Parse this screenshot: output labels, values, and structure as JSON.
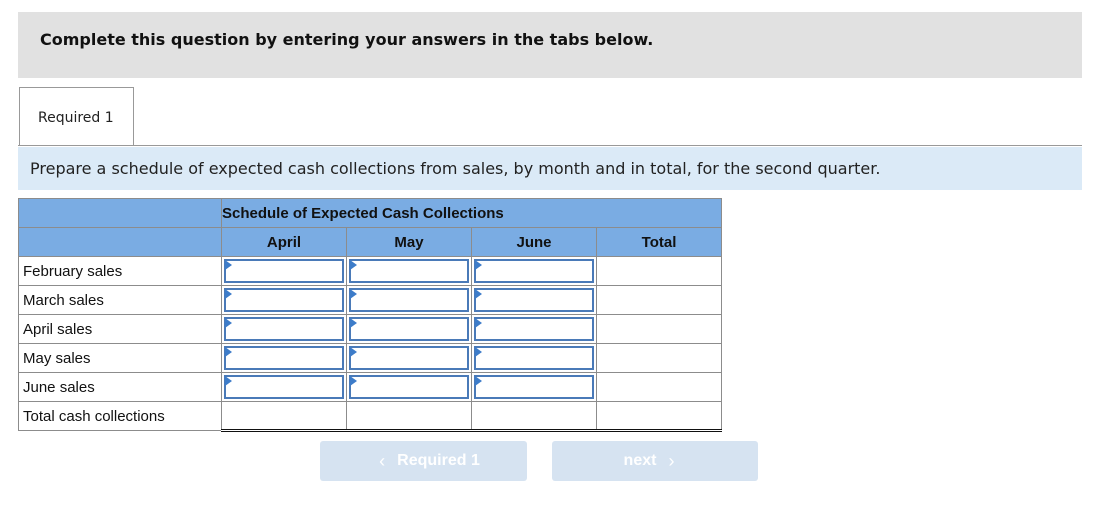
{
  "banner": {
    "text": "Complete this question by entering your answers in the tabs below."
  },
  "tabs": [
    {
      "label": "Required 1",
      "active": true
    }
  ],
  "instruction": "Prepare a schedule of expected cash collections from sales, by month and in total, for the second quarter.",
  "schedule": {
    "title": "Schedule of Expected Cash Collections",
    "columns": [
      "April",
      "May",
      "June",
      "Total"
    ],
    "rows": [
      {
        "label": "February sales",
        "values": [
          "",
          "",
          ""
        ],
        "total": ""
      },
      {
        "label": "March sales",
        "values": [
          "",
          "",
          ""
        ],
        "total": ""
      },
      {
        "label": "April sales",
        "values": [
          "",
          "",
          ""
        ],
        "total": ""
      },
      {
        "label": "May sales",
        "values": [
          "",
          "",
          ""
        ],
        "total": ""
      },
      {
        "label": "June sales",
        "values": [
          "",
          "",
          ""
        ],
        "total": ""
      }
    ],
    "total_row": {
      "label": "Total cash collections",
      "values": [
        "",
        "",
        "",
        ""
      ]
    }
  },
  "navigation": {
    "prev_label": "Required 1",
    "prev_icon": "chevron-left-icon",
    "next_label": "next",
    "next_icon": "chevron-right-icon"
  },
  "colors": {
    "header_blue": "#7aace3",
    "instruction_bg": "#dbeaf7",
    "banner_bg": "#e1e1e1",
    "input_border": "#4a7ab8",
    "nav_button_bg": "#d6e3f1"
  }
}
